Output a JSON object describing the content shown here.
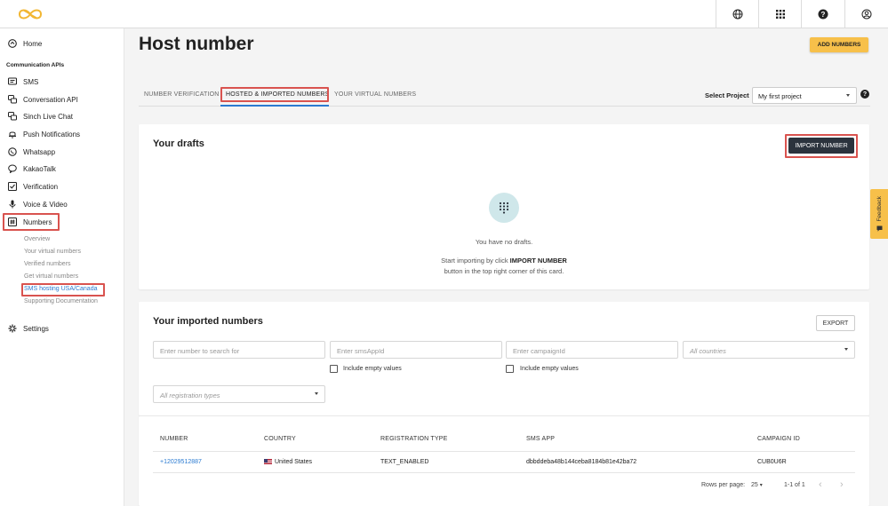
{
  "header": {
    "icons": [
      "globe-icon",
      "apps-grid-icon",
      "help-icon",
      "account-icon"
    ]
  },
  "sidebar": {
    "home": "Home",
    "section_title": "Communication APIs",
    "items": [
      "SMS",
      "Conversation API",
      "Sinch Live Chat",
      "Push Notifications",
      "Whatsapp",
      "KakaoTalk",
      "Verification",
      "Voice & Video",
      "Numbers"
    ],
    "numbers_sub": [
      "Overview",
      "Your virtual numbers",
      "Verified numbers",
      "Get virtual numbers",
      "SMS hosting USA/Canada",
      "Supporting Documentation"
    ],
    "settings": "Settings"
  },
  "main": {
    "title": "Host number",
    "add_numbers": "ADD NUMBERS",
    "tabs": [
      "NUMBER VERIFICATION",
      "HOSTED & IMPORTED NUMBERS",
      "YOUR VIRTUAL NUMBERS"
    ],
    "select_project_label": "Select Project",
    "select_project_value": "My first project",
    "help": "?"
  },
  "drafts": {
    "title": "Your drafts",
    "import_button": "IMPORT NUMBER",
    "empty_text": "You have no drafts.",
    "hint_prefix": "Start importing by click ",
    "hint_bold": "IMPORT NUMBER",
    "hint_line2": "button in the top right corner of this card."
  },
  "imported": {
    "title": "Your imported numbers",
    "export": "EXPORT",
    "search_placeholder": "Enter number to search for",
    "smsapp_placeholder": "Enter smsAppId",
    "campaign_placeholder": "Enter campaignId",
    "countries_placeholder": "All countries",
    "include_empty": "Include empty values",
    "registration_placeholder": "All registration types",
    "columns": [
      "NUMBER",
      "COUNTRY",
      "REGISTRATION TYPE",
      "SMS APP",
      "CAMPAIGN ID"
    ],
    "rows": [
      {
        "number": "+12029512887",
        "country": "United States",
        "registration": "TEXT_ENABLED",
        "sms_app": "dbbddeba48b144ceba8184b81e42ba72",
        "campaign": "CUB0U6R"
      }
    ],
    "rows_per_page_label": "Rows per page:",
    "rows_per_page": "25",
    "range": "1-1 of 1"
  },
  "feedback": "Feedback",
  "colors": {
    "accent_yellow": "#f7c04a",
    "highlight_red": "#d9534f",
    "link_blue": "#2a7ad1",
    "dark_button": "#2b333d"
  }
}
